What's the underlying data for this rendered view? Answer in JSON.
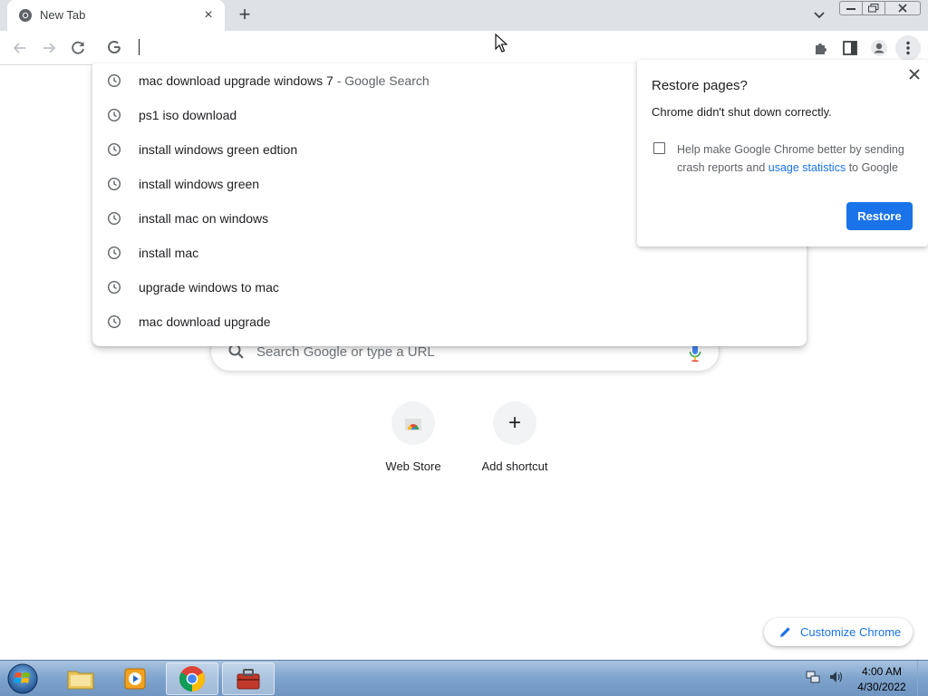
{
  "tab": {
    "title": "New Tab",
    "close": "×"
  },
  "newtab": "+",
  "suggestions": [
    {
      "text": "mac download upgrade windows 7",
      "suffix": " - Google Search"
    },
    {
      "text": "ps1 iso download",
      "suffix": ""
    },
    {
      "text": "install windows green edtion",
      "suffix": ""
    },
    {
      "text": "install windows green",
      "suffix": ""
    },
    {
      "text": "install mac on windows",
      "suffix": ""
    },
    {
      "text": "install mac",
      "suffix": ""
    },
    {
      "text": "upgrade windows to mac",
      "suffix": ""
    },
    {
      "text": "mac download upgrade",
      "suffix": ""
    }
  ],
  "restore": {
    "title": "Restore pages?",
    "message": "Chrome didn't shut down correctly.",
    "checkbox_pre": "Help make Google Chrome better by sending crash reports and ",
    "checkbox_link": "usage statistics",
    "checkbox_post": " to Google",
    "button": "Restore"
  },
  "search": {
    "placeholder": "Search Google or type a URL"
  },
  "shortcuts": [
    {
      "label": "Web Store"
    },
    {
      "label": "Add shortcut",
      "icon": "+"
    }
  ],
  "customize": {
    "label": "Customize Chrome"
  },
  "taskbar": {
    "time": "4:00 AM",
    "date": "4/30/2022"
  },
  "colors": {
    "accent": "#1a73e8",
    "tabstrip": "#dee1e6"
  }
}
